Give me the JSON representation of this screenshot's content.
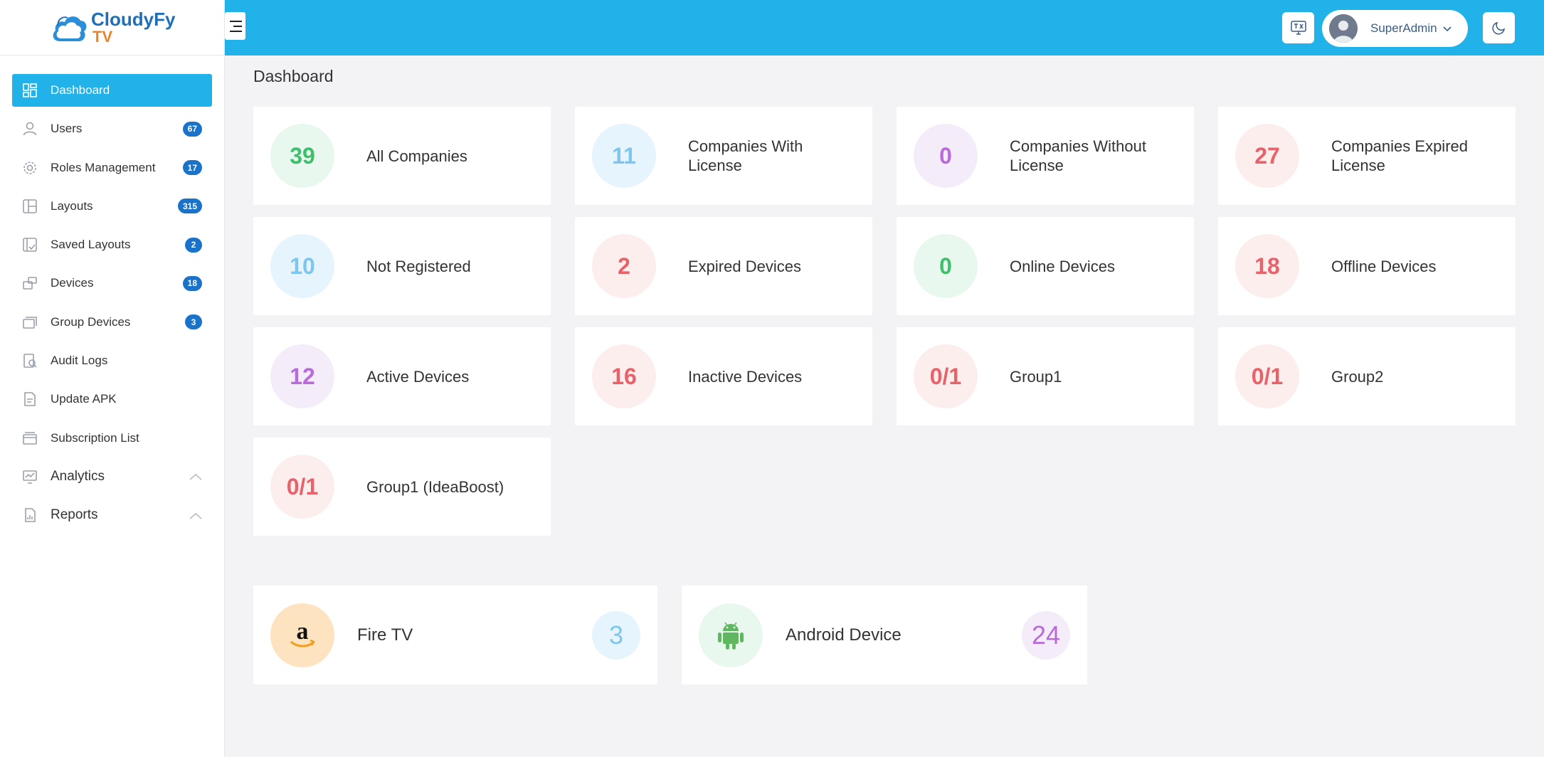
{
  "brand": {
    "name": "CloudyFy",
    "sub": "TV"
  },
  "sidebar": {
    "items": [
      {
        "label": "Dashboard",
        "badge": ""
      },
      {
        "label": "Users",
        "badge": "67"
      },
      {
        "label": "Roles Management",
        "badge": "17"
      },
      {
        "label": "Layouts",
        "badge": "315"
      },
      {
        "label": "Saved Layouts",
        "badge": "2"
      },
      {
        "label": "Devices",
        "badge": "18"
      },
      {
        "label": "Group Devices",
        "badge": "3"
      },
      {
        "label": "Audit Logs",
        "badge": ""
      },
      {
        "label": "Update APK",
        "badge": ""
      },
      {
        "label": "Subscription List",
        "badge": ""
      },
      {
        "label": "Analytics",
        "badge": ""
      },
      {
        "label": "Reports",
        "badge": ""
      }
    ]
  },
  "header": {
    "user_name": "SuperAdmin"
  },
  "main": {
    "title": "Dashboard",
    "cards": [
      {
        "value": "39",
        "label": "All Companies"
      },
      {
        "value": "11",
        "label": "Companies With License"
      },
      {
        "value": "0",
        "label": "Companies Without License"
      },
      {
        "value": "27",
        "label": "Companies Expired License"
      },
      {
        "value": "10",
        "label": "Not Registered"
      },
      {
        "value": "2",
        "label": "Expired Devices"
      },
      {
        "value": "0",
        "label": "Online Devices"
      },
      {
        "value": "18",
        "label": "Offline Devices"
      },
      {
        "value": "12",
        "label": "Active Devices"
      },
      {
        "value": "16",
        "label": "Inactive Devices"
      },
      {
        "value": "0/1",
        "label": "Group1"
      },
      {
        "value": "0/1",
        "label": "Group2"
      },
      {
        "value": "0/1",
        "label": "Group1 (IdeaBoost)"
      }
    ],
    "device_types": [
      {
        "label": "Fire TV",
        "count": "3"
      },
      {
        "label": "Android Device",
        "count": "24"
      }
    ]
  },
  "colors": {
    "accent": "#20b2e8",
    "badge": "#1a73c9"
  }
}
